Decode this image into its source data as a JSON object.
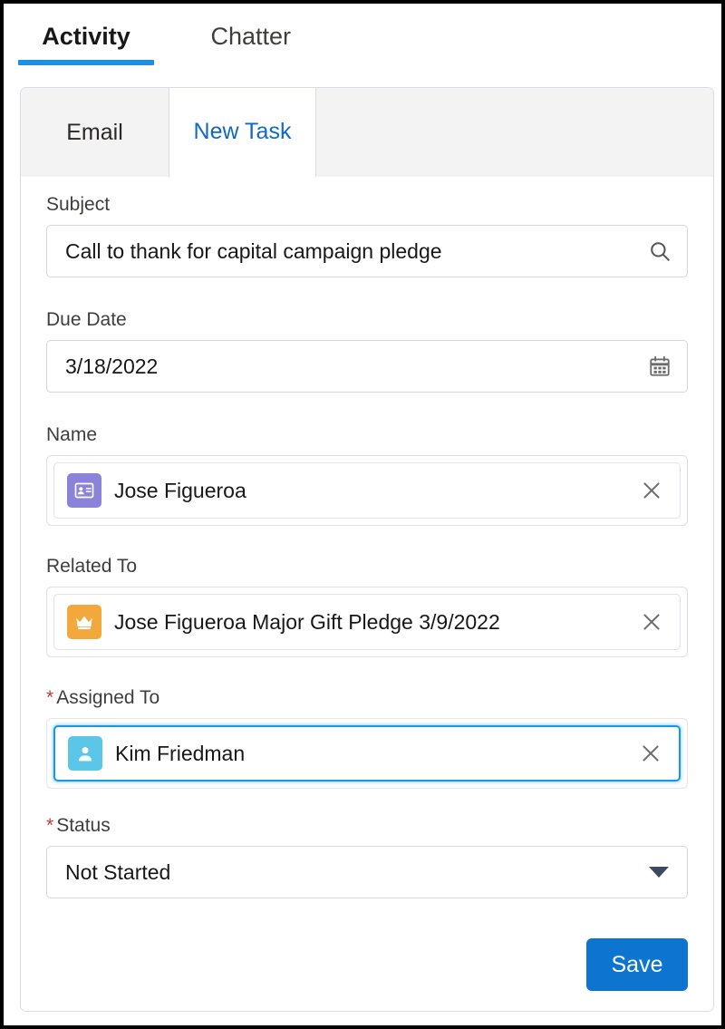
{
  "window": {
    "top_tabs": [
      {
        "label": "Activity",
        "active": true
      },
      {
        "label": "Chatter",
        "active": false
      }
    ]
  },
  "composer": {
    "sub_tabs": [
      {
        "label": "Email",
        "active": false
      },
      {
        "label": "New Task",
        "active": true
      }
    ],
    "fields": {
      "subject": {
        "label": "Subject",
        "value": "Call to thank for capital campaign pledge",
        "placeholder": "",
        "icon": "search-icon",
        "required": false
      },
      "due_date": {
        "label": "Due Date",
        "value": "3/18/2022",
        "placeholder": "",
        "icon": "calendar-icon",
        "required": false
      },
      "name": {
        "label": "Name",
        "value": "Jose Figueroa",
        "icon": "contact-card-icon",
        "icon_color": "#8b82d9",
        "clear_icon": "close-icon",
        "required": false,
        "focused": false
      },
      "related_to": {
        "label": "Related To",
        "value": "Jose Figueroa Major Gift Pledge 3/9/2022",
        "icon": "crown-icon",
        "icon_color": "#f2a83c",
        "clear_icon": "close-icon",
        "required": false,
        "focused": false
      },
      "assigned_to": {
        "label": "Assigned To",
        "value": "Kim Friedman",
        "icon": "user-icon",
        "icon_color": "#5bc6e8",
        "clear_icon": "close-icon",
        "required": true,
        "required_marker": "*",
        "focused": true
      },
      "status": {
        "label": "Status",
        "value": "Not Started",
        "icon": "chevron-down-icon",
        "required": true,
        "required_marker": "*"
      }
    },
    "actions": {
      "save_label": "Save"
    }
  },
  "colors": {
    "accent_blue": "#1b8fe3",
    "link_blue": "#1268c8",
    "save_blue": "#0d75cf",
    "required_red": "#c23934",
    "focus_blue": "#1b96e0"
  }
}
